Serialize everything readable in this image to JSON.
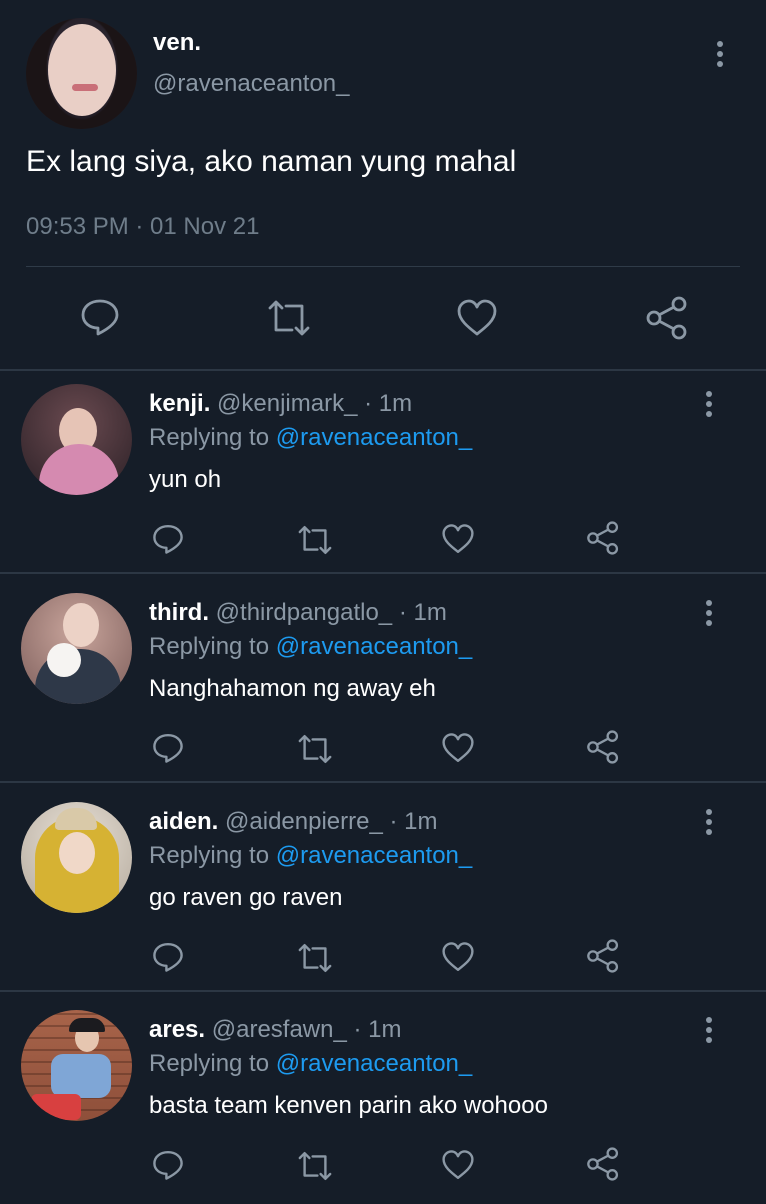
{
  "tweet": {
    "name": "ven.",
    "handle": "@ravenaceanton_",
    "text": "Ex lang siya, ako naman yung mahal",
    "timestamp": "09:53 PM · 01 Nov 21",
    "actions": [
      "reply-icon",
      "retweet-icon",
      "like-icon",
      "share-icon"
    ]
  },
  "replies": [
    {
      "name": "kenji.",
      "handle": "@kenjimark_",
      "time": "· 1m",
      "replying_label": "Replying to ",
      "replying_to": "@ravenaceanton_",
      "text": "yun oh"
    },
    {
      "name": "third.",
      "handle": "@thirdpangatlo_",
      "time": "· 1m",
      "replying_label": "Replying to ",
      "replying_to": "@ravenaceanton_",
      "text": "Nanghahamon ng away eh"
    },
    {
      "name": "aiden.",
      "handle": "@aidenpierre_",
      "time": "· 1m",
      "replying_label": "Replying to ",
      "replying_to": "@ravenaceanton_",
      "text": "go raven go raven"
    },
    {
      "name": "ares.",
      "handle": "@aresfawn_",
      "time": "· 1m",
      "replying_label": "Replying to ",
      "replying_to": "@ravenaceanton_",
      "text": "basta team kenven parin ako wohooo"
    }
  ],
  "colors": {
    "background": "#151d28",
    "muted_text": "#8b98a5",
    "mention": "#1d9bf0",
    "icon": "#8b98a5"
  }
}
